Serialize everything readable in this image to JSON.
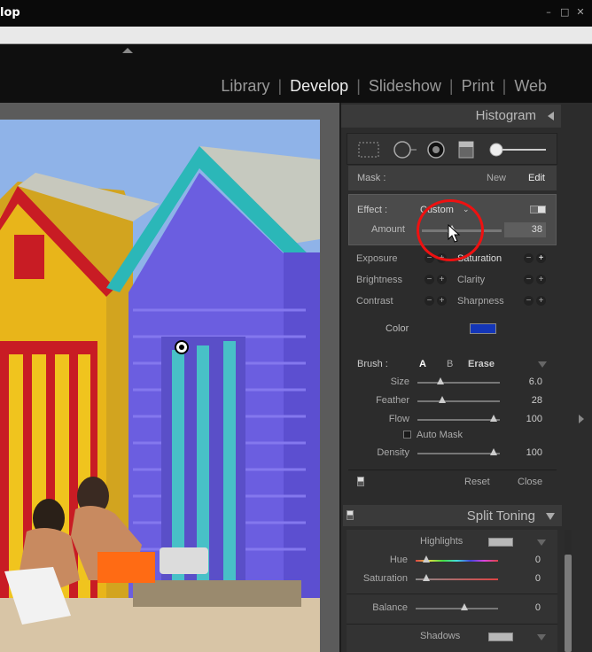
{
  "window": {
    "title": "lop",
    "controls": [
      "–",
      "□",
      "✕"
    ]
  },
  "modules": [
    {
      "label": "Library",
      "active": false
    },
    {
      "label": "Develop",
      "active": true
    },
    {
      "label": "Slideshow",
      "active": false
    },
    {
      "label": "Print",
      "active": false
    },
    {
      "label": "Web",
      "active": false
    }
  ],
  "histogram": {
    "label": "Histogram"
  },
  "tools": [
    "crop-overlay-icon",
    "spot-removal-icon",
    "red-eye-icon",
    "graduated-filter-icon",
    "adjustment-brush-icon"
  ],
  "mask": {
    "label": "Mask :",
    "new": "New",
    "edit": "Edit"
  },
  "effect": {
    "label": "Effect :",
    "value": "Custom",
    "amount_label": "Amount",
    "amount_value": "38",
    "amount_fraction": 0.38
  },
  "adjustments": [
    {
      "label": "Exposure",
      "active": false
    },
    {
      "label": "Saturation",
      "active": true
    },
    {
      "label": "Brightness",
      "active": false
    },
    {
      "label": "Clarity",
      "active": false
    },
    {
      "label": "Contrast",
      "active": false
    },
    {
      "label": "Sharpness",
      "active": false
    }
  ],
  "color": {
    "label": "Color",
    "swatch": "#1436b8"
  },
  "brush": {
    "label": "Brush :",
    "a": "A",
    "b": "B",
    "erase": "Erase",
    "size": {
      "label": "Size",
      "value": "6.0",
      "fraction": 0.28
    },
    "feather": {
      "label": "Feather",
      "value": "28",
      "fraction": 0.28
    },
    "flow": {
      "label": "Flow",
      "value": "100",
      "fraction": 0.92
    },
    "automask": "Auto Mask",
    "density": {
      "label": "Density",
      "value": "100",
      "fraction": 0.92
    }
  },
  "footer": {
    "reset": "Reset",
    "close": "Close"
  },
  "split_toning": {
    "label": "Split Toning",
    "highlights": "Highlights",
    "hue": {
      "label": "Hue",
      "value": "0"
    },
    "saturation": {
      "label": "Saturation",
      "value": "0"
    },
    "balance": {
      "label": "Balance",
      "value": "0",
      "fraction": 0.5
    },
    "shadows": "Shadows"
  }
}
